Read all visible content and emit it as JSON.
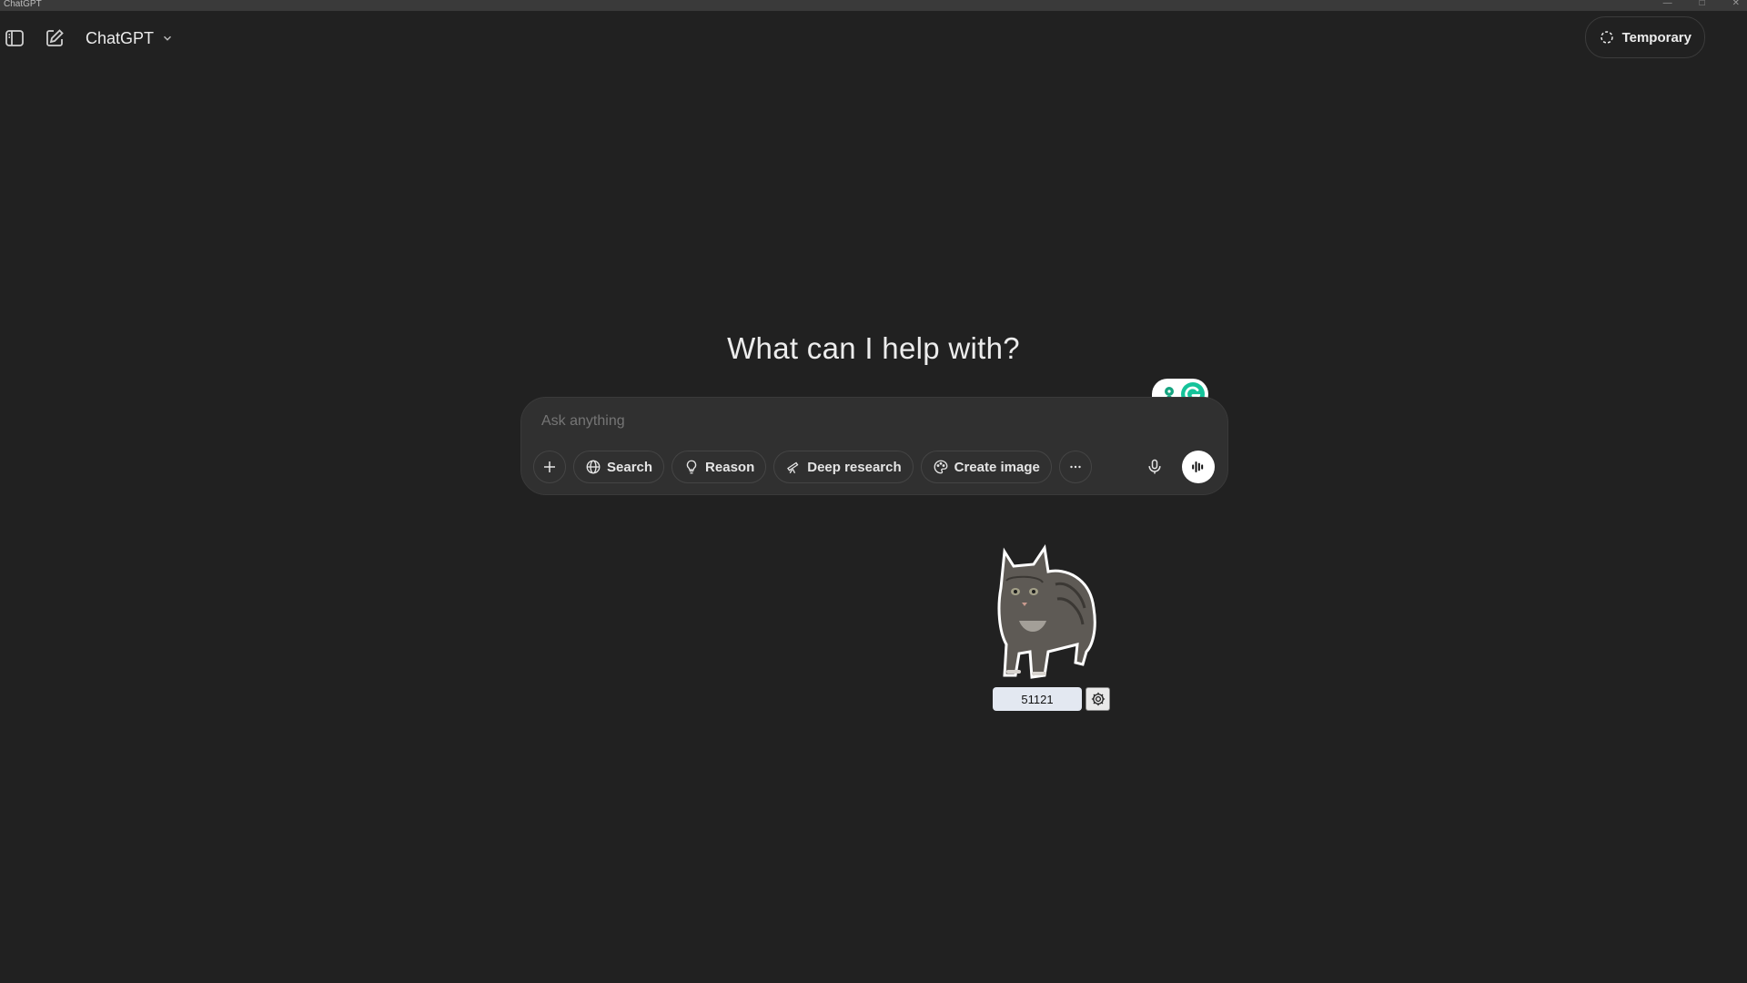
{
  "window": {
    "title": "ChatGPT"
  },
  "topbar": {
    "model_label": "ChatGPT",
    "temporary_label": "Temporary"
  },
  "main": {
    "headline": "What can I help with?"
  },
  "composer": {
    "placeholder": "Ask anything",
    "tools": {
      "search": "Search",
      "reason": "Reason",
      "deep_research": "Deep research",
      "create_image": "Create image"
    }
  },
  "desktop_pet": {
    "counter": "51121"
  },
  "colors": {
    "background": "#212121",
    "composer": "#303030",
    "grammarly": "#15c39a"
  }
}
